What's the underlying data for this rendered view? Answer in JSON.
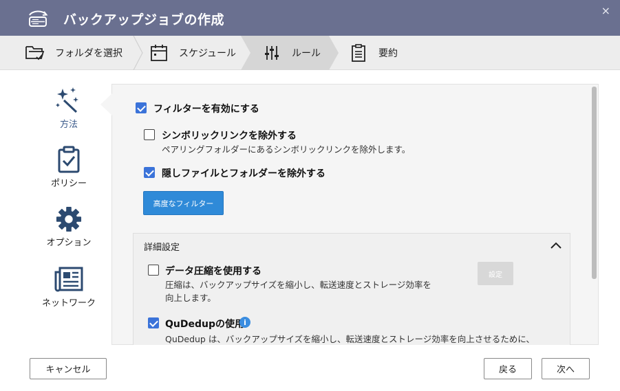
{
  "window": {
    "title": "バックアップジョブの作成",
    "app_icon": "backup-sync-icon",
    "close_glyph": "×",
    "colors": {
      "titlebar": "#6a7090",
      "accent": "#3b73d9",
      "button_primary": "#2f8ad8"
    }
  },
  "steps": [
    {
      "label": "フォルダを選択",
      "icon": "folder-check-icon",
      "active": false
    },
    {
      "label": "スケジュール",
      "icon": "calendar-icon",
      "active": false
    },
    {
      "label": "ルール",
      "icon": "sliders-icon",
      "active": true
    },
    {
      "label": "要約",
      "icon": "clipboard-list-icon",
      "active": false
    }
  ],
  "sidebar": {
    "items": [
      {
        "label": "方法",
        "icon": "magic-wand-icon",
        "active": true
      },
      {
        "label": "ポリシー",
        "icon": "clipboard-check-icon",
        "active": false
      },
      {
        "label": "オプション",
        "icon": "gear-icon",
        "active": false
      },
      {
        "label": "ネットワーク",
        "icon": "newspaper-icon",
        "active": false
      }
    ]
  },
  "filters": {
    "enable": {
      "label": "フィルターを有効にする",
      "checked": true
    },
    "exclude_symlinks": {
      "label": "シンボリックリンクを除外する",
      "description": "ペアリングフォルダーにあるシンボリックリンクを除外します。",
      "checked": false
    },
    "exclude_hidden": {
      "label": "隠しファイルとフォルダーを除外する",
      "checked": true
    },
    "advanced_button": "高度なフィルター"
  },
  "advanced_settings": {
    "title": "詳細設定",
    "collapse_icon": "chevron-up-icon",
    "compression": {
      "label": "データ圧縮を使用する",
      "description_1": "圧縮は、バックアップサイズを縮小し、転送速度とストレージ効率を",
      "description_2": "向上します。",
      "checked": false,
      "settings_button": "設定"
    },
    "qudedup": {
      "label": "QuDedupの使用",
      "info_glyph": "i",
      "description": "QuDedup は、バックアップサイズを縮小し、転送速度とストレージ効率を向上させるために、",
      "checked": true
    }
  },
  "footer": {
    "cancel": "キャンセル",
    "back": "戻る",
    "next": "次へ"
  }
}
